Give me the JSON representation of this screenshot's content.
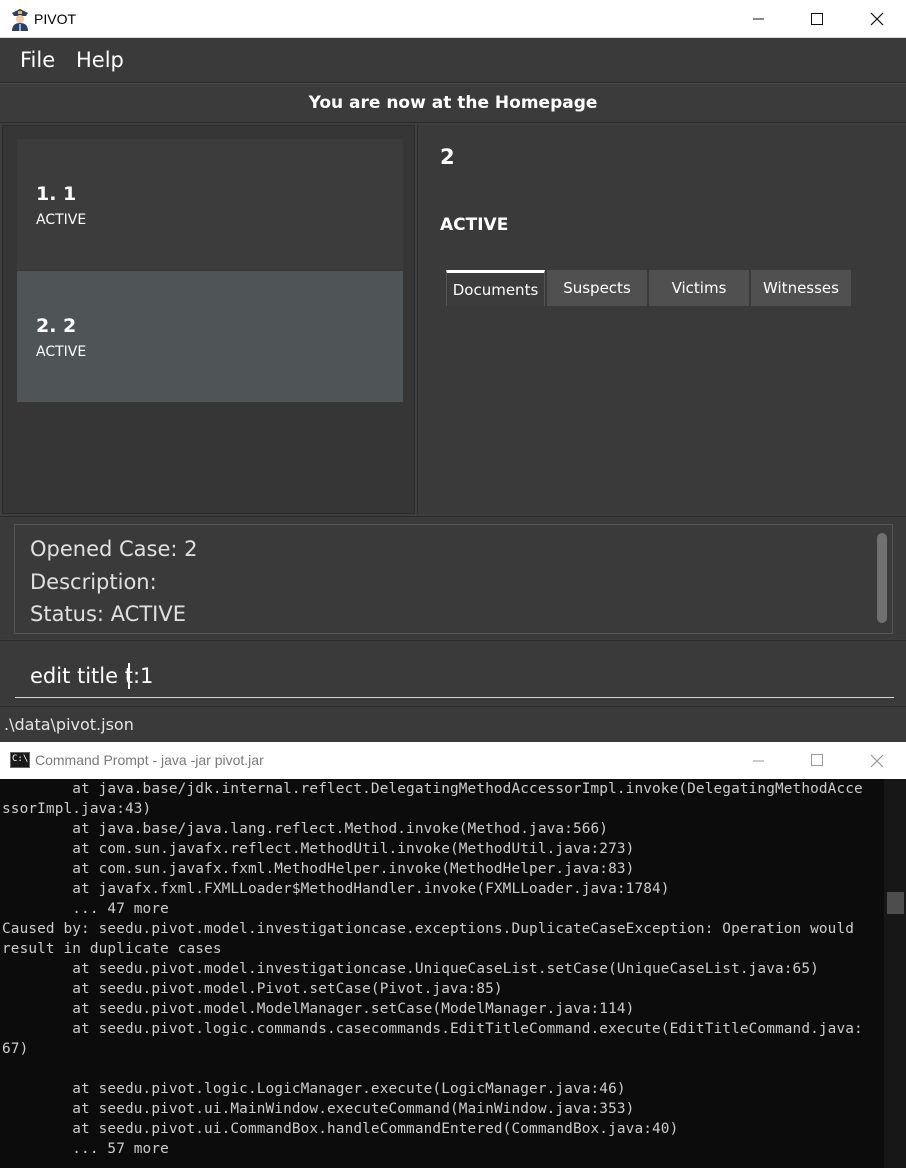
{
  "pivot": {
    "window_title": "PIVOT",
    "menu": [
      "File",
      "Help"
    ],
    "banner": "You are now at the Homepage",
    "cases": [
      {
        "title": "1.  1",
        "status": "ACTIVE"
      },
      {
        "title": "2.  2",
        "status": "ACTIVE"
      }
    ],
    "detail": {
      "title": "2",
      "status": "ACTIVE",
      "tabs": [
        "Documents",
        "Suspects",
        "Victims",
        "Witnesses"
      ],
      "active_tab": "Documents"
    },
    "result": [
      "Opened Case: 2",
      "Description:",
      "Status: ACTIVE"
    ],
    "command": {
      "value": "edit title t:1"
    },
    "status_path": ".\\data\\pivot.json"
  },
  "cmd": {
    "window_title": "Command Prompt - java  -jar pivot.jar",
    "lines": [
      "        at java.base/jdk.internal.reflect.DelegatingMethodAccessorImpl.invoke(DelegatingMethodAcce",
      "ssorImpl.java:43)",
      "        at java.base/java.lang.reflect.Method.invoke(Method.java:566)",
      "        at com.sun.javafx.reflect.MethodUtil.invoke(MethodUtil.java:273)",
      "        at com.sun.javafx.fxml.MethodHelper.invoke(MethodHelper.java:83)",
      "        at javafx.fxml.FXMLLoader$MethodHandler.invoke(FXMLLoader.java:1784)",
      "        ... 47 more",
      "Caused by: seedu.pivot.model.investigationcase.exceptions.DuplicateCaseException: Operation would",
      "result in duplicate cases",
      "        at seedu.pivot.model.investigationcase.UniqueCaseList.setCase(UniqueCaseList.java:65)",
      "        at seedu.pivot.model.Pivot.setCase(Pivot.java:85)",
      "        at seedu.pivot.model.ModelManager.setCase(ModelManager.java:114)",
      "        at seedu.pivot.logic.commands.casecommands.EditTitleCommand.execute(EditTitleCommand.java:",
      "67)",
      "",
      "        at seedu.pivot.logic.LogicManager.execute(LogicManager.java:46)",
      "        at seedu.pivot.ui.MainWindow.executeCommand(MainWindow.java:353)",
      "        at seedu.pivot.ui.CommandBox.handleCommandEntered(CommandBox.java:40)",
      "        ... 57 more"
    ]
  }
}
